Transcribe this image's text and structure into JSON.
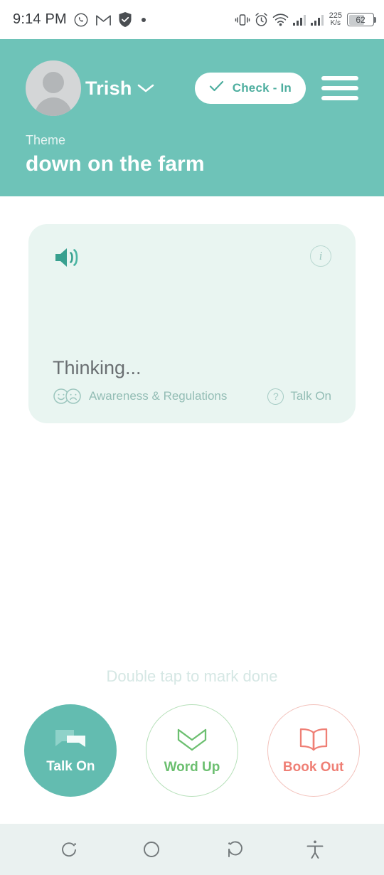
{
  "status_bar": {
    "time": "9:14 PM",
    "left_icons": [
      "whatsapp-icon",
      "gmail-icon",
      "shield-icon",
      "dot-icon"
    ],
    "right_icons": [
      "vibrate-icon",
      "alarm-icon",
      "wifi-icon",
      "signal-sim1-icon",
      "signal-sim2-icon"
    ],
    "net_speed_value": "225",
    "net_speed_unit": "K/s",
    "battery_percent": "62"
  },
  "header": {
    "user_name": "Trish",
    "avatar": "user-avatar",
    "dropdown_icon": "chevron-down-icon",
    "check_in_label": "Check - In",
    "check_in_icon": "check-icon",
    "menu_icon": "hamburger-menu-icon",
    "theme_label": "Theme",
    "theme_title": "down on the farm",
    "background_color": "#6ec3b8"
  },
  "card": {
    "speaker_icon": "speaker-icon",
    "info_icon": "info-icon",
    "status_text": "Thinking...",
    "category_icons": [
      "smiley-face-icon",
      "sad-face-icon"
    ],
    "category_label": "Awareness & Regulations",
    "help_icon": "question-mark-icon",
    "help_label": "Talk On",
    "background_color": "#e9f5f1"
  },
  "main": {
    "hint_text": "Double tap to mark done",
    "actions": [
      {
        "label": "Talk On",
        "icon": "speech-bubbles-icon",
        "color": "#63bcb0",
        "style": "filled"
      },
      {
        "label": "Word Up",
        "icon": "crown-icon",
        "color": "#6cbf70",
        "style": "outline"
      },
      {
        "label": "Book Out",
        "icon": "open-book-icon",
        "color": "#ef7f75",
        "style": "outline"
      }
    ]
  },
  "nav_bar": {
    "items": [
      "recents-icon",
      "home-icon",
      "back-icon",
      "accessibility-icon"
    ]
  }
}
